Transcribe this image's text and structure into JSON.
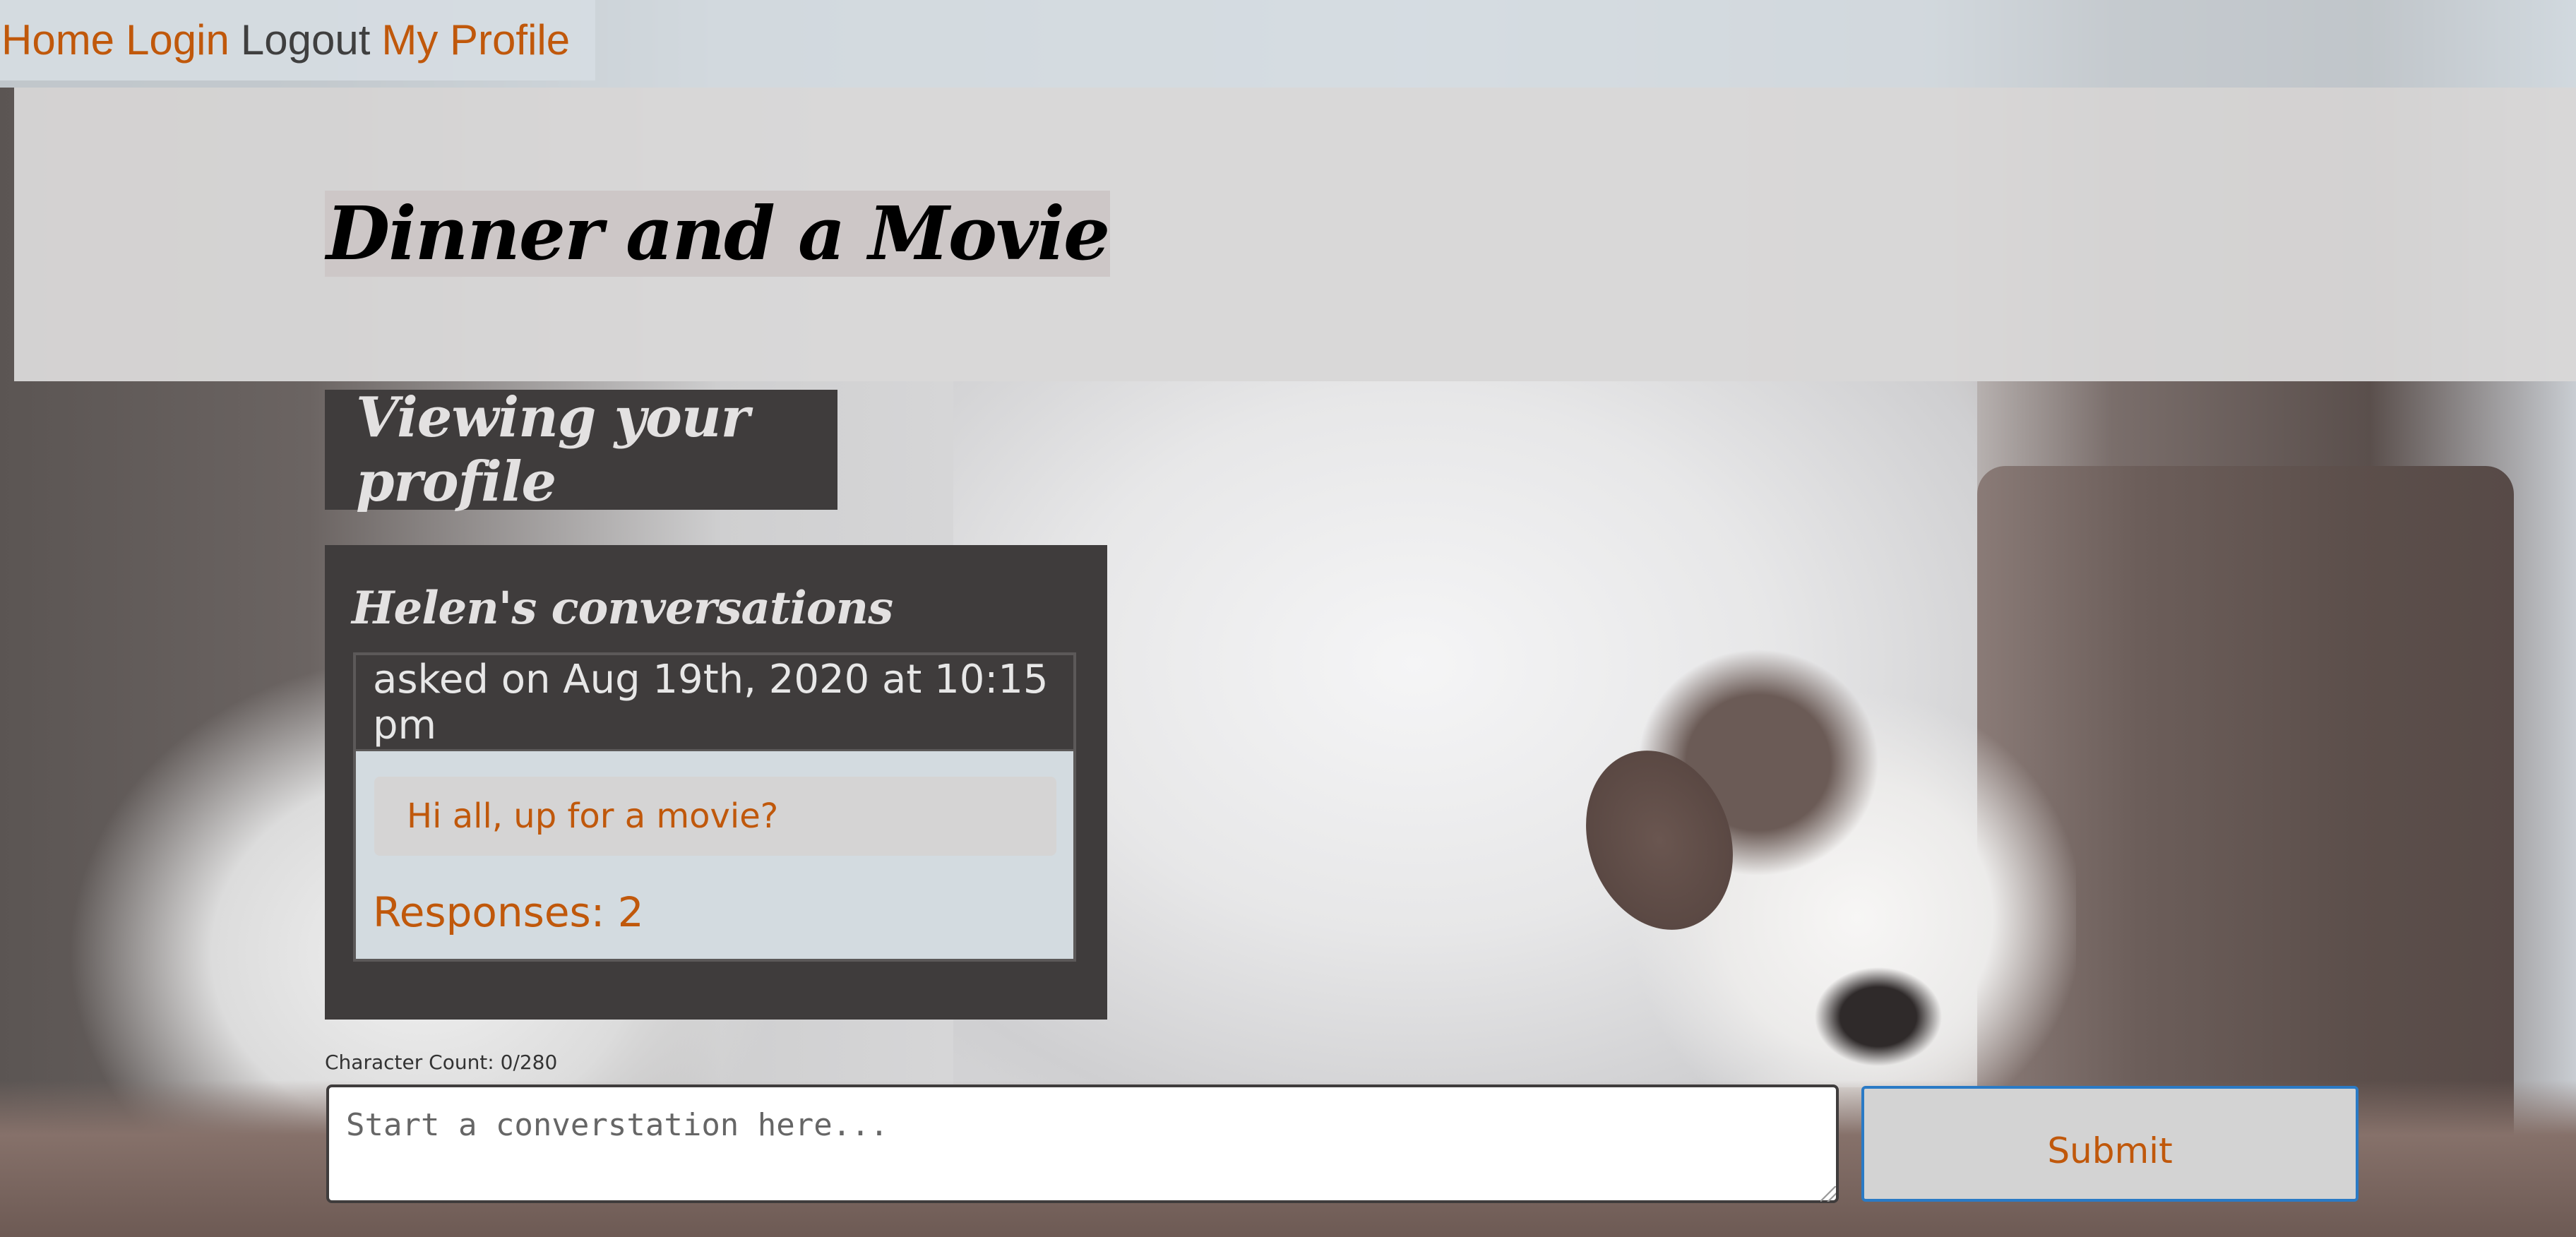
{
  "nav": {
    "home": "Home",
    "login": "Login",
    "logout": "Logout",
    "profile": "My Profile"
  },
  "banner": {
    "title": "Dinner and a Movie"
  },
  "profile": {
    "heading": "Viewing your profile",
    "conversations_title": "Helen's conversations"
  },
  "conversations": [
    {
      "asked_on": "asked on Aug 19th, 2020 at 10:15 pm",
      "message": "Hi all, up for a movie?",
      "responses": "Responses: 2"
    }
  ],
  "composer": {
    "char_count": "Character Count: 0/280",
    "placeholder": "Start a converstation here...",
    "value": "",
    "submit_label": "Submit"
  },
  "colors": {
    "link": "#c0580b",
    "panel": "#3f3c3c",
    "submit_border": "#2a7ac5"
  }
}
